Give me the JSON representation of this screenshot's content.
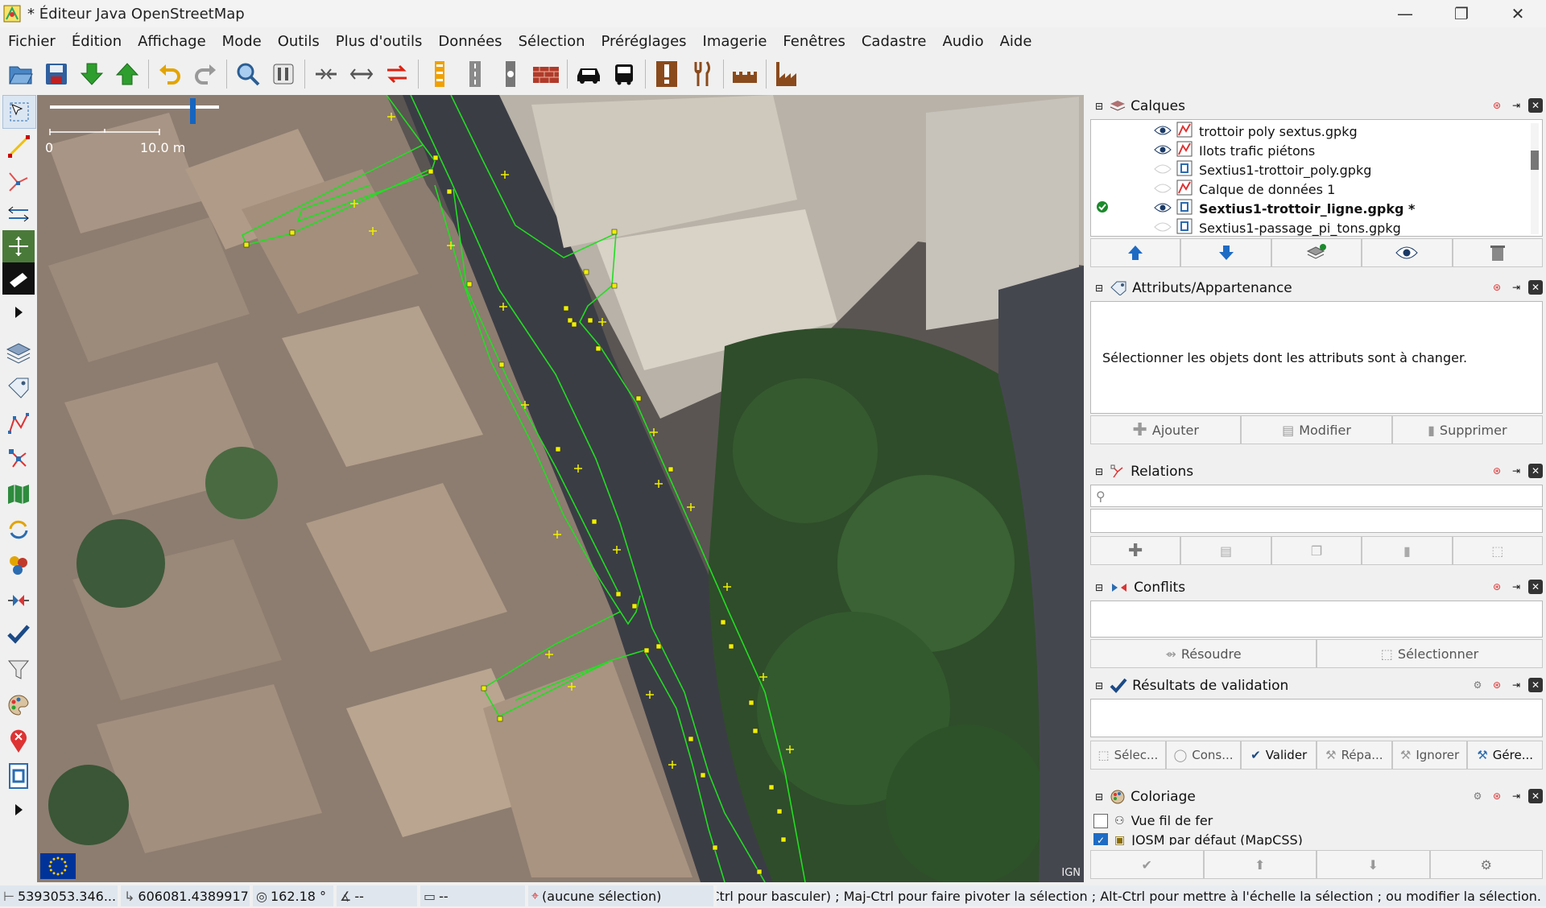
{
  "window": {
    "title": "* Éditeur Java OpenStreetMap",
    "controls": {
      "minimize": "—",
      "restore": "❐",
      "close": "✕"
    }
  },
  "menu": [
    "Fichier",
    "Édition",
    "Affichage",
    "Mode",
    "Outils",
    "Plus d'outils",
    "Données",
    "Sélection",
    "Préréglages",
    "Imagerie",
    "Fenêtres",
    "Cadastre",
    "Audio",
    "Aide"
  ],
  "toolbar_icons": [
    "open-icon",
    "save-icon",
    "download-icon",
    "upload-icon",
    "undo-icon",
    "redo-icon",
    "zoom-icon",
    "preferences-icon",
    "combine-way-icon",
    "split-way-icon",
    "reverse-way-icon",
    "crossing-icon",
    "road-icon",
    "traffic-signals-icon",
    "wall-icon",
    "car-icon",
    "bus-icon",
    "hazard-icon",
    "restaurant-icon",
    "castle-icon",
    "industrial-icon"
  ],
  "map": {
    "scale_start": "0",
    "scale_label": "10.0 m",
    "attribution": "IGN"
  },
  "panels": {
    "layers": {
      "title": "Calques",
      "items": [
        {
          "name": "trottoir poly sextus.gpkg",
          "visible": true,
          "active": false,
          "bold": false
        },
        {
          "name": "Ilots trafic piétons",
          "visible": true,
          "active": false,
          "bold": false
        },
        {
          "name": "Sextius1-trottoir_poly.gpkg",
          "visible": false,
          "active": false,
          "bold": false
        },
        {
          "name": "Calque de données 1",
          "visible": false,
          "active": false,
          "bold": false
        },
        {
          "name": "Sextius1-trottoir_ligne.gpkg *",
          "visible": true,
          "active": true,
          "bold": true
        },
        {
          "name": "Sextius1-passage_pi_tons.gpkg",
          "visible": false,
          "active": false,
          "bold": false
        }
      ]
    },
    "attributes": {
      "title": "Attributs/Appartenance",
      "message": "Sélectionner les objets dont les attributs sont à changer.",
      "add": "Ajouter",
      "edit": "Modifier",
      "delete": "Supprimer"
    },
    "relations": {
      "title": "Relations"
    },
    "conflicts": {
      "title": "Conflits",
      "resolve": "Résoudre",
      "select": "Sélectionner"
    },
    "validation": {
      "title": "Résultats de validation",
      "select": "Sélec...",
      "inspect": "Cons...",
      "validate": "Valider",
      "fix": "Répa...",
      "ignore": "Ignorer",
      "manage": "Gére..."
    },
    "styles": {
      "title": "Coloriage",
      "items": [
        {
          "name": "Vue fil de fer",
          "checked": false
        },
        {
          "name": "JOSM par défaut (MapCSS)",
          "checked": true
        }
      ]
    }
  },
  "status": {
    "lat": "5393053.346...",
    "lon": "606081.4389917",
    "heading": "162.18 °",
    "angle": "--",
    "distance": "--",
    "selection": "(aucune sélection)",
    "message": "élection (Ctrl pour basculer) ; Maj-Ctrl pour faire pivoter la sélection ; Alt-Ctrl pour mettre à l'échelle la sélection ; ou modifier la sélection."
  },
  "colors": {
    "way": "#22dd22",
    "node": "#f0f000",
    "accent": "#1565c0"
  }
}
